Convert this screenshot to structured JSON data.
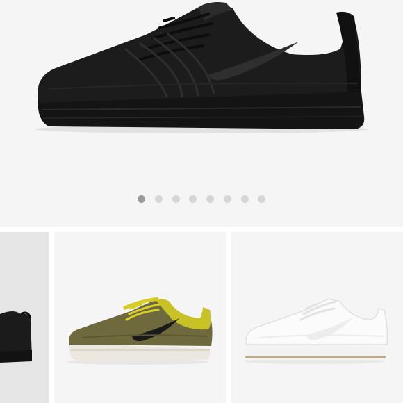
{
  "gallery": {
    "hero_image": "black-knit-sneaker",
    "page_count": 8,
    "active_index": 0,
    "colors": {
      "background": "#f5f5f5",
      "dot_active": "#9a9a9a",
      "dot_inactive": "#d6d6d6",
      "selected_thumb_bg": "#e6e6e6"
    }
  },
  "thumbnails": [
    {
      "image": "black-knit-sneaker",
      "selected": true
    },
    {
      "image": "olive-yellow-knit-sneaker",
      "selected": false
    },
    {
      "image": "white-knit-sneaker",
      "selected": false
    }
  ]
}
